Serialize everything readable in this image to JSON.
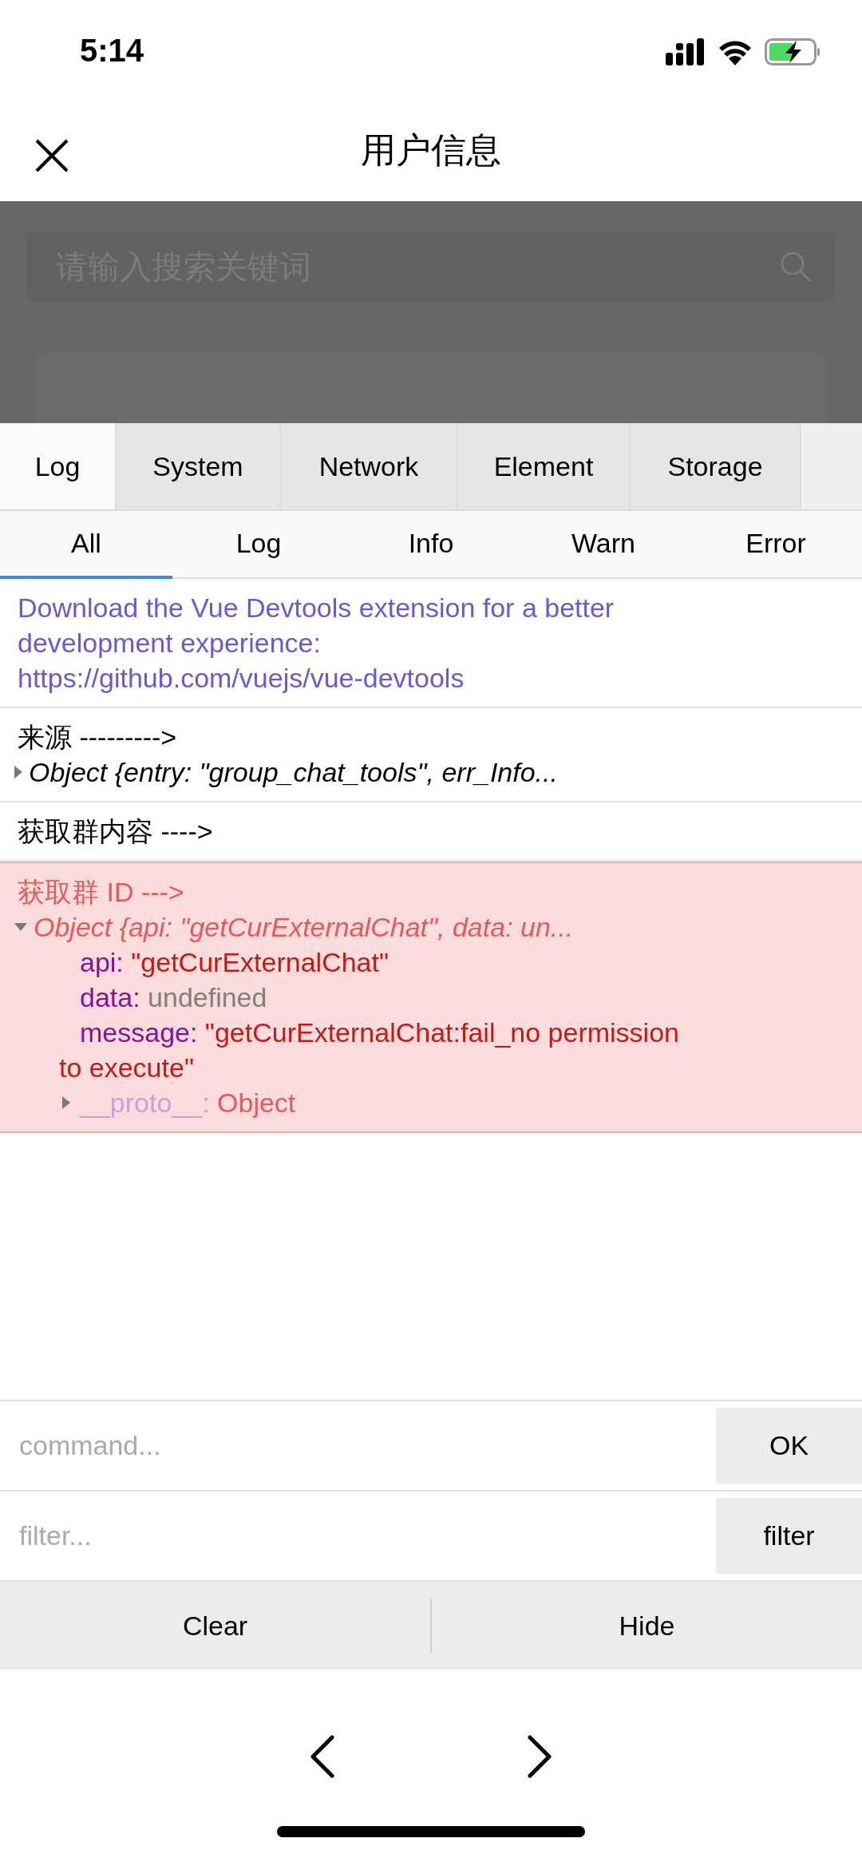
{
  "status_bar": {
    "time": "5:14"
  },
  "nav": {
    "title": "用户信息"
  },
  "page": {
    "search": {
      "placeholder": "请输入搜索关键词"
    }
  },
  "devtools": {
    "tabs": [
      {
        "label": "Log",
        "selected": true
      },
      {
        "label": "System",
        "selected": false
      },
      {
        "label": "Network",
        "selected": false
      },
      {
        "label": "Element",
        "selected": false
      },
      {
        "label": "Storage",
        "selected": false
      }
    ],
    "filters": [
      {
        "label": "All",
        "selected": true
      },
      {
        "label": "Log",
        "selected": false
      },
      {
        "label": "Info",
        "selected": false
      },
      {
        "label": "Warn",
        "selected": false
      },
      {
        "label": "Error",
        "selected": false
      }
    ],
    "logs": [
      {
        "kind": "info",
        "lines": [
          {
            "kind": "text",
            "text": "Download the Vue Devtools extension for a better development experience:\nhttps://github.com/vuejs/vue-devtools"
          }
        ]
      },
      {
        "kind": "log",
        "lines": [
          {
            "kind": "text",
            "text": "来源 --------->"
          },
          {
            "kind": "object",
            "expanded": false,
            "summary": "Object {entry: \"group_chat_tools\", err_Info..."
          }
        ]
      },
      {
        "kind": "log",
        "lines": [
          {
            "kind": "text",
            "text": "获取群内容 ---->"
          }
        ]
      },
      {
        "kind": "error",
        "lines": [
          {
            "kind": "text",
            "text": "获取群 ID --->"
          },
          {
            "kind": "object",
            "expanded": true,
            "summary": "Object {api: \"getCurExternalChat\", data: un...",
            "children": [
              {
                "key": "api:",
                "kind": "string",
                "value": "\"getCurExternalChat\""
              },
              {
                "key": "data:",
                "kind": "undefined",
                "value": "undefined"
              },
              {
                "key": "message:",
                "kind": "string",
                "value": "\"getCurExternalChat:fail_no permission to execute\""
              },
              {
                "key": "__proto__:",
                "kind": "proto",
                "value": "Object",
                "expanded": false
              }
            ]
          }
        ]
      }
    ],
    "command": {
      "placeholder": "command...",
      "button": "OK"
    },
    "filter": {
      "placeholder": "filter...",
      "button": "filter"
    },
    "actions": [
      "Clear",
      "Hide"
    ]
  }
}
